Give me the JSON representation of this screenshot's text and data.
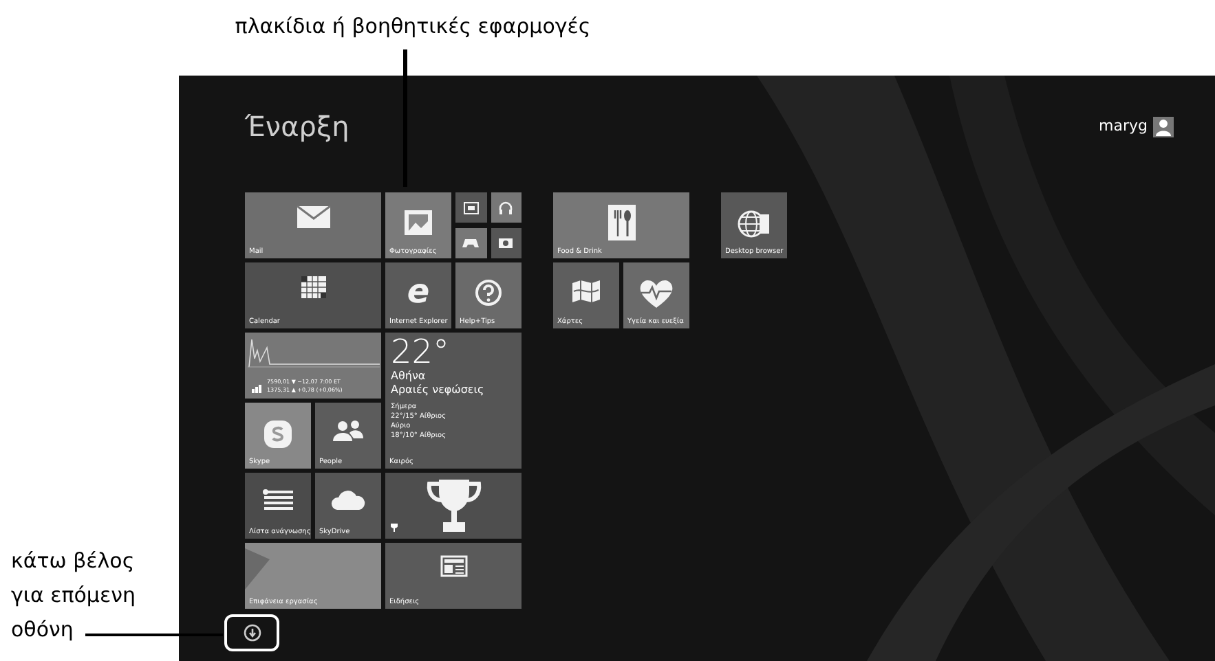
{
  "annotations": {
    "top_callout": "πλακίδια ή βοηθητικές εφαρμογές",
    "bottom_callout": [
      "κάτω βέλος",
      "για επόμενη",
      "οθόνη"
    ]
  },
  "screen": {
    "title": "Έναρξη",
    "user": "maryg",
    "groups": [
      {
        "tiles": [
          {
            "kind": "mail",
            "label": "Mail"
          },
          {
            "kind": "photos",
            "label": "Φωτογραφίες"
          },
          {
            "kind": "smallset",
            "items": [
              {
                "kind": "video"
              },
              {
                "kind": "headphones"
              },
              {
                "kind": "gamepad"
              },
              {
                "kind": "camera"
              }
            ]
          },
          {
            "kind": "calendar",
            "label": "Calendar"
          },
          {
            "kind": "browser",
            "glyph": "e",
            "label": "Internet Explorer"
          },
          {
            "kind": "help",
            "label": "Help+Tips"
          },
          {
            "kind": "finance",
            "lines": [
              "7590,01 ▼ −12,07 7:00 ET",
              "1375,31 ▲ +0,78 (+0,06%)"
            ]
          },
          {
            "kind": "skype",
            "label": "Skype"
          },
          {
            "kind": "people",
            "label": "People"
          },
          {
            "kind": "weather",
            "temp": "22°",
            "city": "Αθήνα",
            "condition": "Αραιές νεφώσεις",
            "forecast": [
              "Σήμερα",
              "22°/15° Αίθριος",
              "Αύριο",
              "18°/10° Αίθριος"
            ],
            "label": "Καιρός"
          },
          {
            "kind": "reading",
            "label": "Λίστα ανάγνωσης"
          },
          {
            "kind": "cloud",
            "label": "SkyDrive"
          },
          {
            "kind": "trophy"
          },
          {
            "kind": "desktop",
            "label": "Επιφάνεια εργασίας"
          },
          {
            "kind": "news",
            "label": "Ειδήσεις"
          }
        ]
      },
      {
        "tiles": [
          {
            "kind": "food",
            "label": "Food & Drink"
          },
          {
            "kind": "maps",
            "label": "Χάρτες"
          },
          {
            "kind": "health",
            "label": "Υγεία και ευεξία"
          }
        ]
      },
      {
        "tiles": [
          {
            "kind": "globe",
            "label": "Desktop browser"
          }
        ]
      }
    ]
  }
}
